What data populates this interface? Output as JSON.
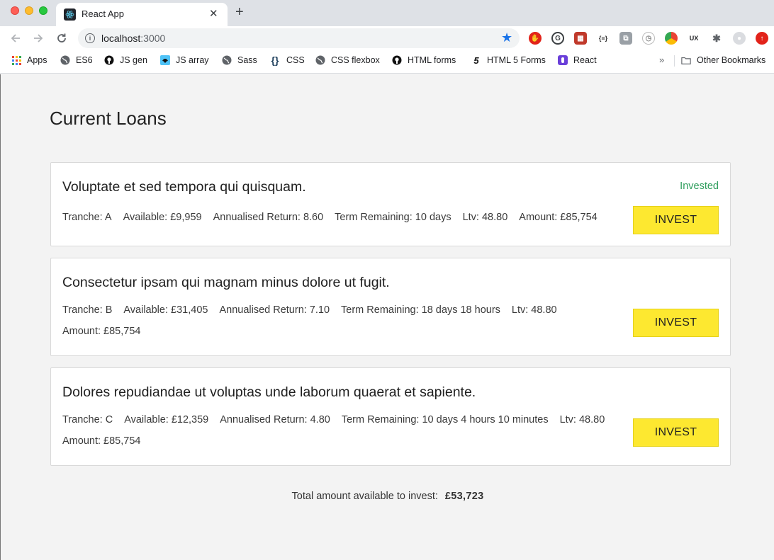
{
  "browser": {
    "tab_title": "React App",
    "url_host": "localhost",
    "url_port": ":3000",
    "bookmarks": [
      "Apps",
      "ES6",
      "JS gen",
      "JS array",
      "Sass",
      "CSS",
      "CSS flexbox",
      "HTML forms",
      "HTML 5 Forms",
      "React"
    ],
    "other_bookmarks": "Other Bookmarks"
  },
  "page": {
    "title": "Current Loans",
    "loans": [
      {
        "title": "Voluptate et sed tempora qui quisquam.",
        "status": "Invested",
        "tranche": "Tranche: A",
        "available": "Available: £9,959",
        "annualised_return": "Annualised Return: 8.60",
        "term_remaining": "Term Remaining: 10 days",
        "ltv": "Ltv: 48.80",
        "amount": "Amount: £85,754",
        "button": "INVEST"
      },
      {
        "title": "Consectetur ipsam qui magnam minus dolore ut fugit.",
        "status": "",
        "tranche": "Tranche: B",
        "available": "Available: £31,405",
        "annualised_return": "Annualised Return: 7.10",
        "term_remaining": "Term Remaining: 18 days 18 hours",
        "ltv": "Ltv: 48.80",
        "amount": "Amount: £85,754",
        "button": "INVEST"
      },
      {
        "title": "Dolores repudiandae ut voluptas unde laborum quaerat et sapiente.",
        "status": "",
        "tranche": "Tranche: C",
        "available": "Available: £12,359",
        "annualised_return": "Annualised Return: 4.80",
        "term_remaining": "Term Remaining: 10 days 4 hours 10 minutes",
        "ltv": "Ltv: 48.80",
        "amount": "Amount: £85,754",
        "button": "INVEST"
      }
    ],
    "total_label": "Total amount available to invest:",
    "total_value": "£53,723"
  },
  "colors": {
    "invest_button": "#fde830",
    "invested_status": "#2e9d5c",
    "accent_star": "#1a73e8"
  }
}
